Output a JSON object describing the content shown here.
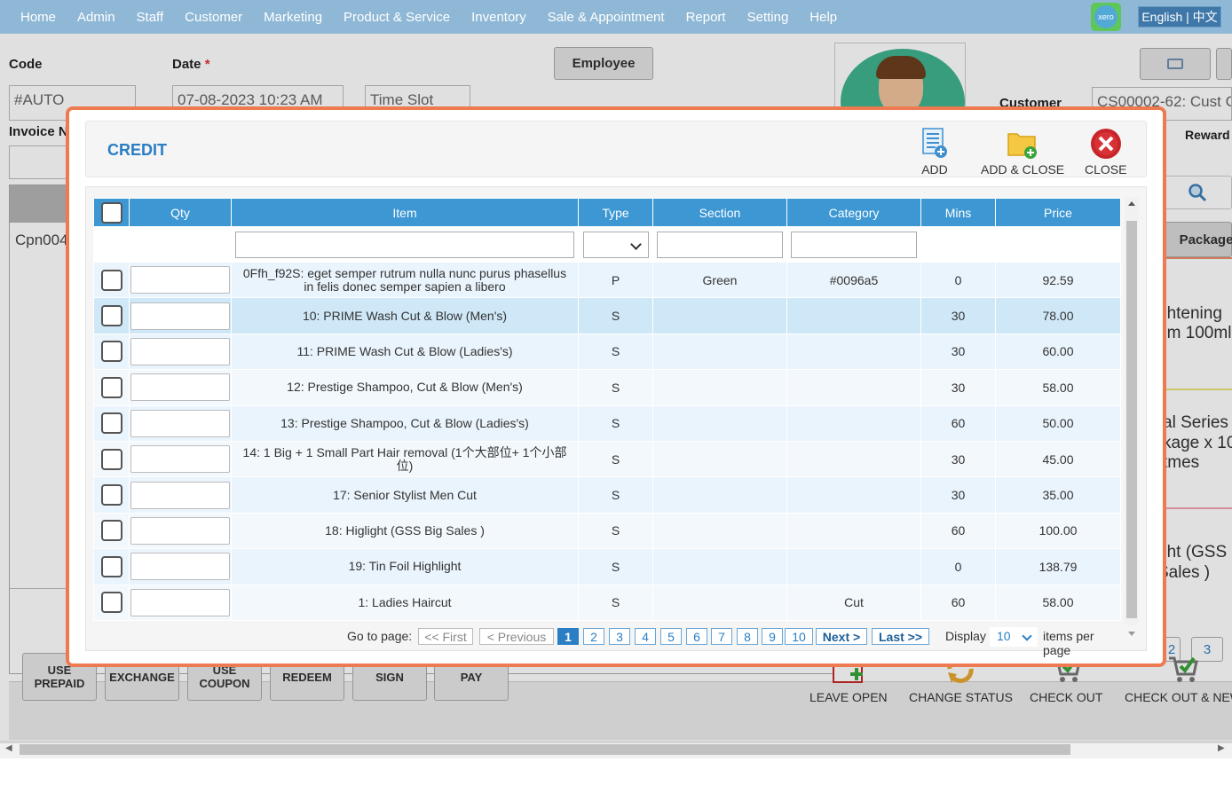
{
  "nav": {
    "menu": [
      "Home",
      "Admin",
      "Staff",
      "Customer",
      "Marketing",
      "Product & Service",
      "Inventory",
      "Sale & Appointment",
      "Report",
      "Setting",
      "Help"
    ],
    "xero": "xero",
    "language": "English | 中文"
  },
  "form": {
    "code_label": "Code",
    "code_value": "#AUTO",
    "date_label": "Date",
    "date_required": "*",
    "date_value": "07-08-2023 10:23 AM",
    "timeslot_value": "Time Slot",
    "employee_button": "Employee",
    "invoice_label": "Invoice N",
    "customer_label": "Customer",
    "customer_value": "CS00002-62: Cust C",
    "reward_label": "Reward",
    "row_text": "Cpn004",
    "package_label": "Package",
    "side_items": [
      "ghtening",
      "em 100ml",
      "al Series",
      "kage x 10",
      "tmes",
      "ght (GSS",
      "Sales )"
    ],
    "side_page": "3",
    "side_page_prev": "2"
  },
  "bottom_buttons": [
    "USE PREPAID",
    "EXCHANGE",
    "USE COUPON",
    "REDEEM",
    "SIGN",
    "PAY"
  ],
  "bottom_actions": [
    "LEAVE OPEN",
    "CHANGE STATUS",
    "CHECK OUT",
    "CHECK OUT & NEW"
  ],
  "dialog": {
    "title": "CREDIT",
    "actions": {
      "add": "ADD",
      "add_close": "ADD & CLOSE",
      "close": "CLOSE"
    },
    "columns": [
      "Qty",
      "Item",
      "Type",
      "Section",
      "Category",
      "Mins",
      "Price"
    ],
    "rows": [
      {
        "item": "0Ffh_f92S: eget semper rutrum nulla nunc purus phasellus in felis donec semper sapien a libero",
        "type": "P",
        "section": "Green",
        "category": "#0096a5",
        "mins": "0",
        "price": "92.59"
      },
      {
        "item": "10: PRIME Wash Cut & Blow (Men's)",
        "type": "S",
        "section": "",
        "category": "",
        "mins": "30",
        "price": "78.00"
      },
      {
        "item": "11: PRIME Wash Cut & Blow (Ladies's)",
        "type": "S",
        "section": "",
        "category": "",
        "mins": "30",
        "price": "60.00"
      },
      {
        "item": "12: Prestige Shampoo, Cut & Blow (Men's)",
        "type": "S",
        "section": "",
        "category": "",
        "mins": "30",
        "price": "58.00"
      },
      {
        "item": "13: Prestige Shampoo, Cut & Blow (Ladies's)",
        "type": "S",
        "section": "",
        "category": "",
        "mins": "60",
        "price": "50.00"
      },
      {
        "item": "14: 1 Big + 1 Small Part Hair removal (1个大部位+ 1个小部位)",
        "type": "S",
        "section": "",
        "category": "",
        "mins": "30",
        "price": "45.00"
      },
      {
        "item": "17: Senior Stylist Men Cut",
        "type": "S",
        "section": "",
        "category": "",
        "mins": "30",
        "price": "35.00"
      },
      {
        "item": "18: Higlight (GSS Big Sales )",
        "type": "S",
        "section": "",
        "category": "",
        "mins": "60",
        "price": "100.00"
      },
      {
        "item": "19: Tin Foil Highlight",
        "type": "S",
        "section": "",
        "category": "",
        "mins": "0",
        "price": "138.79"
      },
      {
        "item": "1: Ladies Haircut",
        "type": "S",
        "section": "",
        "category": "Cut",
        "mins": "60",
        "price": "58.00"
      }
    ],
    "pager": {
      "goto_label": "Go to page:",
      "first": "<< First",
      "previous": "< Previous",
      "pages": [
        "1",
        "2",
        "3",
        "4",
        "5",
        "6",
        "7",
        "8",
        "9",
        "10"
      ],
      "current_page": "1",
      "next": "Next >",
      "last": "Last >>",
      "display_label": "Display",
      "items_per_page": "10",
      "items_label": "items per page"
    }
  },
  "colors": {
    "nav": "#8fb8d6",
    "header_blue": "#3d97d3",
    "dialog_border": "#ee7a52",
    "title_blue": "#2a7ec4"
  },
  "icons": [
    "add-list-icon",
    "folder-add-icon",
    "close-circle-icon",
    "calendar-add-icon",
    "refresh-icon",
    "cart-check-icon",
    "search-icon",
    "card-icon"
  ]
}
